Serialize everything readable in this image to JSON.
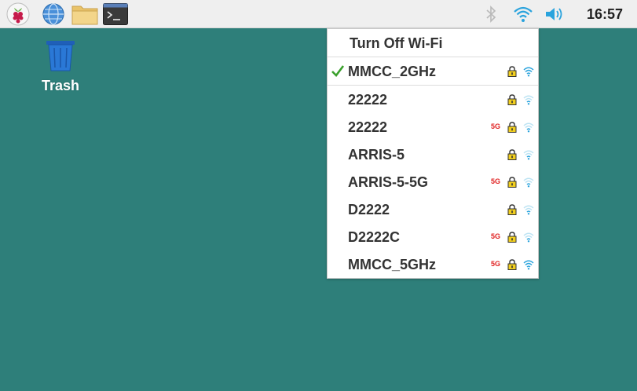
{
  "panel": {
    "clock": "16:57",
    "launchers": [
      "raspberry-menu-icon",
      "web-browser-icon",
      "file-manager-icon",
      "terminal-icon"
    ]
  },
  "desktop": {
    "trash_label": "Trash"
  },
  "wifi_menu": {
    "turn_off_label": "Turn Off Wi-Fi",
    "band_label": "5G",
    "networks": [
      {
        "ssid": "MMCC_2GHz",
        "connected": true,
        "secured": true,
        "band5g": false,
        "signal": "strong"
      },
      {
        "ssid": "22222",
        "connected": false,
        "secured": true,
        "band5g": false,
        "signal": "weak"
      },
      {
        "ssid": "22222",
        "connected": false,
        "secured": true,
        "band5g": true,
        "signal": "weak"
      },
      {
        "ssid": "ARRIS-5",
        "connected": false,
        "secured": true,
        "band5g": false,
        "signal": "weak"
      },
      {
        "ssid": "ARRIS-5-5G",
        "connected": false,
        "secured": true,
        "band5g": true,
        "signal": "weak"
      },
      {
        "ssid": "D2222",
        "connected": false,
        "secured": true,
        "band5g": false,
        "signal": "weak"
      },
      {
        "ssid": "D2222C",
        "connected": false,
        "secured": true,
        "band5g": true,
        "signal": "weak"
      },
      {
        "ssid": "MMCC_5GHz",
        "connected": false,
        "secured": true,
        "band5g": true,
        "signal": "strong"
      }
    ]
  },
  "colors": {
    "desktop_bg": "#2e7f7a",
    "accent_blue": "#2aa3dd",
    "check_green": "#3aa02c",
    "band_red": "#e02020"
  }
}
